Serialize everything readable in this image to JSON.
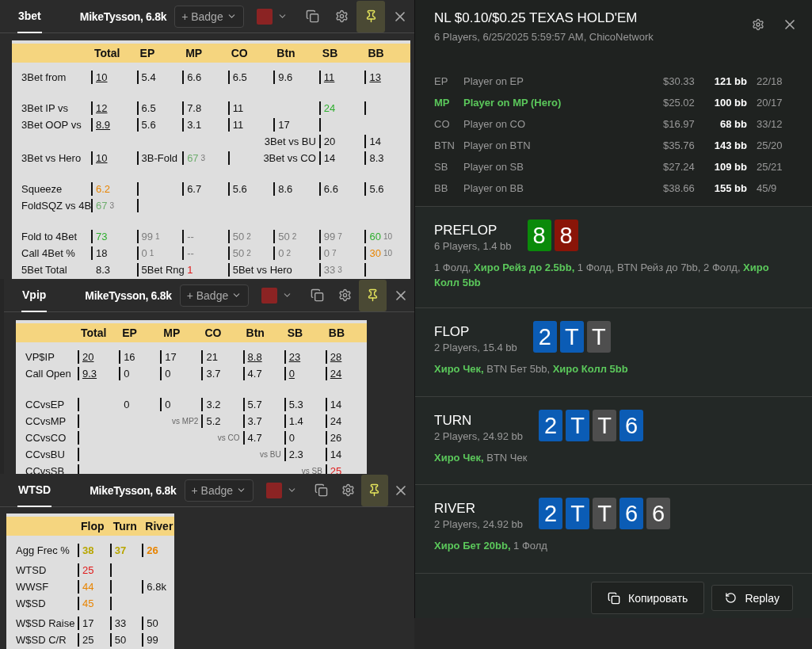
{
  "huds": [
    {
      "tab": {
        "label": "3bet",
        "selected": true
      },
      "player": "MikeTysson, 6.8k",
      "badge": "+ Badge",
      "pinned": true,
      "color": "#8b2323",
      "table": {
        "columns": [
          "Total",
          "EP",
          "MP",
          "CO",
          "Btn",
          "SB",
          "BB"
        ],
        "groups": [
          {
            "rows": [
              {
                "label": "3Bet from",
                "cells": [
                  {
                    "text": "10",
                    "underline": true
                  },
                  {
                    "text": "5.4"
                  },
                  {
                    "text": "6.6"
                  },
                  {
                    "text": "6.5"
                  },
                  {
                    "text": "9.6"
                  },
                  {
                    "text": "11",
                    "underline": true
                  },
                  {
                    "text": "13",
                    "underline": true
                  }
                ]
              }
            ]
          },
          {
            "rows": [
              {
                "label": "3Bet IP vs",
                "cells": [
                  {
                    "text": "12",
                    "underline": true
                  },
                  {
                    "text": "6.5"
                  },
                  {
                    "text": "7.8"
                  },
                  {
                    "text": "11"
                  },
                  "",
                  {
                    "text": "24",
                    "color": "#2fae2f"
                  },
                  {}
                ]
              },
              {
                "label": "3Bet OOP vs",
                "cells": [
                  {
                    "text": "8.9",
                    "underline": true
                  },
                  {
                    "text": "5.6"
                  },
                  {
                    "text": "3.1"
                  },
                  {
                    "text": "11"
                  },
                  {
                    "text": "17"
                  },
                  {},
                  ""
                ]
              },
              {
                "cells": [
                  "",
                  "",
                  "",
                  "",
                  {
                    "text": "3Bet vs BU",
                    "kind": "caption"
                  },
                  {
                    "text": "20"
                  },
                  {
                    "text": "14"
                  }
                ]
              },
              {
                "label": "3Bet vs Hero",
                "cells": [
                  {
                    "text": "10",
                    "underline": true
                  },
                  {
                    "text": "3B-Fold"
                  },
                  {
                    "text": "67",
                    "sub": "3",
                    "color": "#6fae6f"
                  },
                  {},
                  {
                    "text": "3Bet vs CO",
                    "kind": "caption"
                  },
                  {
                    "text": "14"
                  },
                  {
                    "text": "8.3"
                  }
                ]
              }
            ]
          },
          {
            "rows": [
              {
                "label": "Squeeze",
                "cells": [
                  {
                    "text": "6.2",
                    "color": "#e88400"
                  },
                  {},
                  {
                    "text": "6.7"
                  },
                  {
                    "text": "5.6"
                  },
                  {
                    "text": "8.6"
                  },
                  {
                    "text": "6.6"
                  },
                  {
                    "text": "5.6"
                  }
                ]
              },
              {
                "label": "FoldSQZ vs 4B",
                "cells": [
                  {
                    "text": "67",
                    "sub": "3",
                    "color": "#6fae6f"
                  },
                  {}
                ]
              }
            ]
          },
          {
            "rows": [
              {
                "label": "Fold to 4Bet",
                "cells": [
                  {
                    "text": "73",
                    "color": "#2fae2f"
                  },
                  {
                    "text": "99",
                    "sub": "1",
                    "color": "#7d7d7d"
                  },
                  {
                    "text": "--",
                    "color": "#7d7d7d"
                  },
                  {
                    "text": "50",
                    "sub": "2",
                    "color": "#7d7d7d"
                  },
                  {
                    "text": "50",
                    "sub": "2",
                    "color": "#7d7d7d"
                  },
                  {
                    "text": "99",
                    "sub": "7",
                    "color": "#7d7d7d"
                  },
                  {
                    "text": "60",
                    "sub": "10",
                    "color": "#2fae2f"
                  }
                ]
              },
              {
                "label": "Call 4Bet %",
                "cells": [
                  {
                    "text": "18"
                  },
                  {
                    "text": "0",
                    "sub": "1",
                    "color": "#7d7d7d"
                  },
                  {
                    "text": "--",
                    "color": "#7d7d7d"
                  },
                  {
                    "text": "50",
                    "sub": "2",
                    "color": "#7d7d7d"
                  },
                  {
                    "text": "0",
                    "sub": "2",
                    "color": "#7d7d7d"
                  },
                  {
                    "text": "0",
                    "sub": "7",
                    "color": "#7d7d7d"
                  },
                  {
                    "text": "30",
                    "sub": "10",
                    "color": "#e88400"
                  }
                ]
              },
              {
                "label": "5Bet Total",
                "cells": [
                  {
                    "text": "8.3",
                    "plain": true
                  },
                  {
                    "text": "5Bet Rng"
                  },
                  {
                    "text": "1",
                    "color": "#e01818",
                    "plain": true
                  },
                  {
                    "text": "5Bet vs Hero"
                  },
                  "",
                  {
                    "text": "33",
                    "sub": "3",
                    "color": "#7d7d7d"
                  },
                  {}
                ]
              }
            ]
          }
        ]
      }
    },
    {
      "tab": {
        "label": "Vpip",
        "selected": true
      },
      "player": "MikeTysson, 6.8k",
      "badge": "+ Badge",
      "pinned": true,
      "color": "#8b2323",
      "table": {
        "columns": [
          "Total",
          "EP",
          "MP",
          "CO",
          "Btn",
          "SB",
          "BB"
        ],
        "groups": [
          {
            "rows": [
              {
                "label": "VP$IP",
                "cells": [
                  {
                    "text": "20",
                    "underline": true
                  },
                  {
                    "text": "16"
                  },
                  {
                    "text": "17"
                  },
                  {
                    "text": "21"
                  },
                  {
                    "text": "8.8",
                    "underline": true
                  },
                  {
                    "text": "23",
                    "underline": true
                  },
                  {
                    "text": "28",
                    "underline": true
                  }
                ]
              },
              {
                "label": "Call Open",
                "cells": [
                  {
                    "text": "9.3",
                    "underline": true
                  },
                  {
                    "text": "0"
                  },
                  {
                    "text": "0"
                  },
                  {
                    "text": "3.7"
                  },
                  {
                    "text": "4.7"
                  },
                  {
                    "text": "0",
                    "underline": true
                  },
                  {
                    "text": "24",
                    "underline": true
                  }
                ]
              }
            ]
          },
          {
            "rows": [
              {
                "label": "CCvsEP",
                "cells": [
                  {},
                  {
                    "text": "0",
                    "plain": true
                  },
                  {
                    "text": "0"
                  },
                  {
                    "text": "3.2"
                  },
                  {
                    "text": "5.7"
                  },
                  {
                    "text": "5.3"
                  },
                  {
                    "text": "14"
                  }
                ]
              },
              {
                "label": "CCvsMP",
                "cells": [
                  {},
                  "",
                  {
                    "text": "vs MP2",
                    "kind": "note",
                    "plain": true
                  },
                  {
                    "text": "5.2"
                  },
                  {
                    "text": "3.7"
                  },
                  {
                    "text": "1.4"
                  },
                  {
                    "text": "24"
                  }
                ]
              },
              {
                "label": "CCvsCO",
                "cells": [
                  {},
                  "",
                  "",
                  {
                    "text": "vs CO",
                    "kind": "note",
                    "plain": true
                  },
                  {
                    "text": "4.7"
                  },
                  {
                    "text": "0"
                  },
                  {
                    "text": "26"
                  }
                ]
              },
              {
                "label": "CCvsBU",
                "cells": [
                  {},
                  "",
                  "",
                  "",
                  {
                    "text": "vs BU",
                    "kind": "note",
                    "plain": true
                  },
                  {
                    "text": "2.3"
                  },
                  {
                    "text": "14"
                  }
                ]
              },
              {
                "label": "CCvsSB",
                "cells": [
                  {},
                  "",
                  "",
                  "",
                  "",
                  {
                    "text": "vs SB",
                    "kind": "note",
                    "plain": true
                  },
                  {
                    "text": "25",
                    "color": "#e01818"
                  }
                ]
              }
            ]
          }
        ]
      }
    },
    {
      "tab": {
        "label": "WTSD",
        "selected": true
      },
      "player": "MikeTysson, 6.8k",
      "badge": "+ Badge",
      "pinned": true,
      "color": "#8b2323",
      "table": {
        "columns": [
          "Flop",
          "Turn",
          "River"
        ],
        "groups": [
          {
            "rows": [
              {
                "label": "Agg Frec %",
                "cells": [
                  {
                    "text": "38",
                    "color": "#b8a600",
                    "bold": true
                  },
                  {
                    "text": "37",
                    "color": "#b8a600",
                    "bold": true
                  },
                  {
                    "text": "26",
                    "color": "#e88400",
                    "bold": true
                  }
                ]
              }
            ]
          },
          {
            "rows": [
              {
                "label": "WTSD",
                "cells": [
                  {
                    "text": "25",
                    "color": "#e01818"
                  },
                  {}
                ]
              },
              {
                "label": "WWSF",
                "cells": [
                  {
                    "text": "44",
                    "color": "#e88400"
                  },
                  {},
                  {
                    "text": "6.8k"
                  }
                ]
              },
              {
                "label": "W$SD",
                "cells": [
                  {
                    "text": "45",
                    "color": "#e88400"
                  },
                  {}
                ]
              }
            ]
          },
          {
            "rows": [
              {
                "label": "W$SD Raise",
                "cells": [
                  {
                    "text": "17"
                  },
                  {
                    "text": "33"
                  },
                  {
                    "text": "50"
                  }
                ]
              },
              {
                "label": "W$SD C/R",
                "cells": [
                  {
                    "text": "25"
                  },
                  {
                    "text": "50"
                  },
                  {
                    "text": "99"
                  }
                ]
              }
            ]
          }
        ]
      }
    }
  ],
  "hand": {
    "title": "NL $0.10/$0.25 TEXAS HOLD'EM",
    "subtitle": "6 Players, 6/25/2025 5:59:57 AM, ChicoNetwork",
    "players": [
      {
        "position": "EP",
        "name": "Player on EP",
        "stack": "$30.33",
        "bb": "121 bb",
        "stats": "22/18",
        "hero": false
      },
      {
        "position": "MP",
        "name": "Player on MP (Hero)",
        "stack": "$25.02",
        "bb": "100 bb",
        "stats": "20/17",
        "hero": true
      },
      {
        "position": "CO",
        "name": "Player on CO",
        "stack": "$16.97",
        "bb": "68 bb",
        "stats": "33/12",
        "hero": false
      },
      {
        "position": "BTN",
        "name": "Player on BTN",
        "stack": "$35.76",
        "bb": "143 bb",
        "stats": "25/20",
        "hero": false
      },
      {
        "position": "SB",
        "name": "Player on SB",
        "stack": "$27.24",
        "bb": "109 bb",
        "stats": "25/21",
        "hero": false
      },
      {
        "position": "BB",
        "name": "Player on BB",
        "stack": "$38.66",
        "bb": "155 bb",
        "stats": "45/9",
        "hero": false
      }
    ],
    "streets": [
      {
        "name": "PREFLOP",
        "info": "6 Players, 1.4 bb",
        "cards": [
          {
            "rank": "8",
            "color": "#0a8a0a"
          },
          {
            "rank": "8",
            "color": "#8a1508"
          }
        ],
        "actions": "1 Фолд, **Хиро Рейз до 2.5bb,** 1 Фолд, BTN Рейз до 7bb, 2 Фолд, **Хиро Колл 5bb**"
      },
      {
        "name": "FLOP",
        "info": "2 Players, 15.4 bb",
        "cards": [
          {
            "rank": "2",
            "color": "#0b5cb5"
          },
          {
            "rank": "T",
            "color": "#0b5cb5"
          },
          {
            "rank": "T",
            "color": "#4e4e4e"
          }
        ],
        "actions": "**Хиро Чек,** BTN Бет 5bb, **Хиро Колл 5bb**"
      },
      {
        "name": "TURN",
        "info": "2 Players, 24.92 bb",
        "cards": [
          {
            "rank": "2",
            "color": "#0b5cb5"
          },
          {
            "rank": "T",
            "color": "#0b5cb5"
          },
          {
            "rank": "T",
            "color": "#4e4e4e"
          },
          {
            "rank": "6",
            "color": "#0b5cb5"
          }
        ],
        "actions": "**Хиро Чек,** BTN Чек"
      },
      {
        "name": "RIVER",
        "info": "2 Players, 24.92 bb",
        "cards": [
          {
            "rank": "2",
            "color": "#0b5cb5"
          },
          {
            "rank": "T",
            "color": "#0b5cb5"
          },
          {
            "rank": "T",
            "color": "#4e4e4e"
          },
          {
            "rank": "6",
            "color": "#0b5cb5"
          },
          {
            "rank": "6",
            "color": "#4e4e4e"
          }
        ],
        "actions": "**Хиро Бет 20bb,** 1 Фолд"
      }
    ],
    "buttons": [
      {
        "kind": "copy",
        "label": "Копировать"
      },
      {
        "kind": "replay",
        "label": "Replay"
      }
    ]
  }
}
